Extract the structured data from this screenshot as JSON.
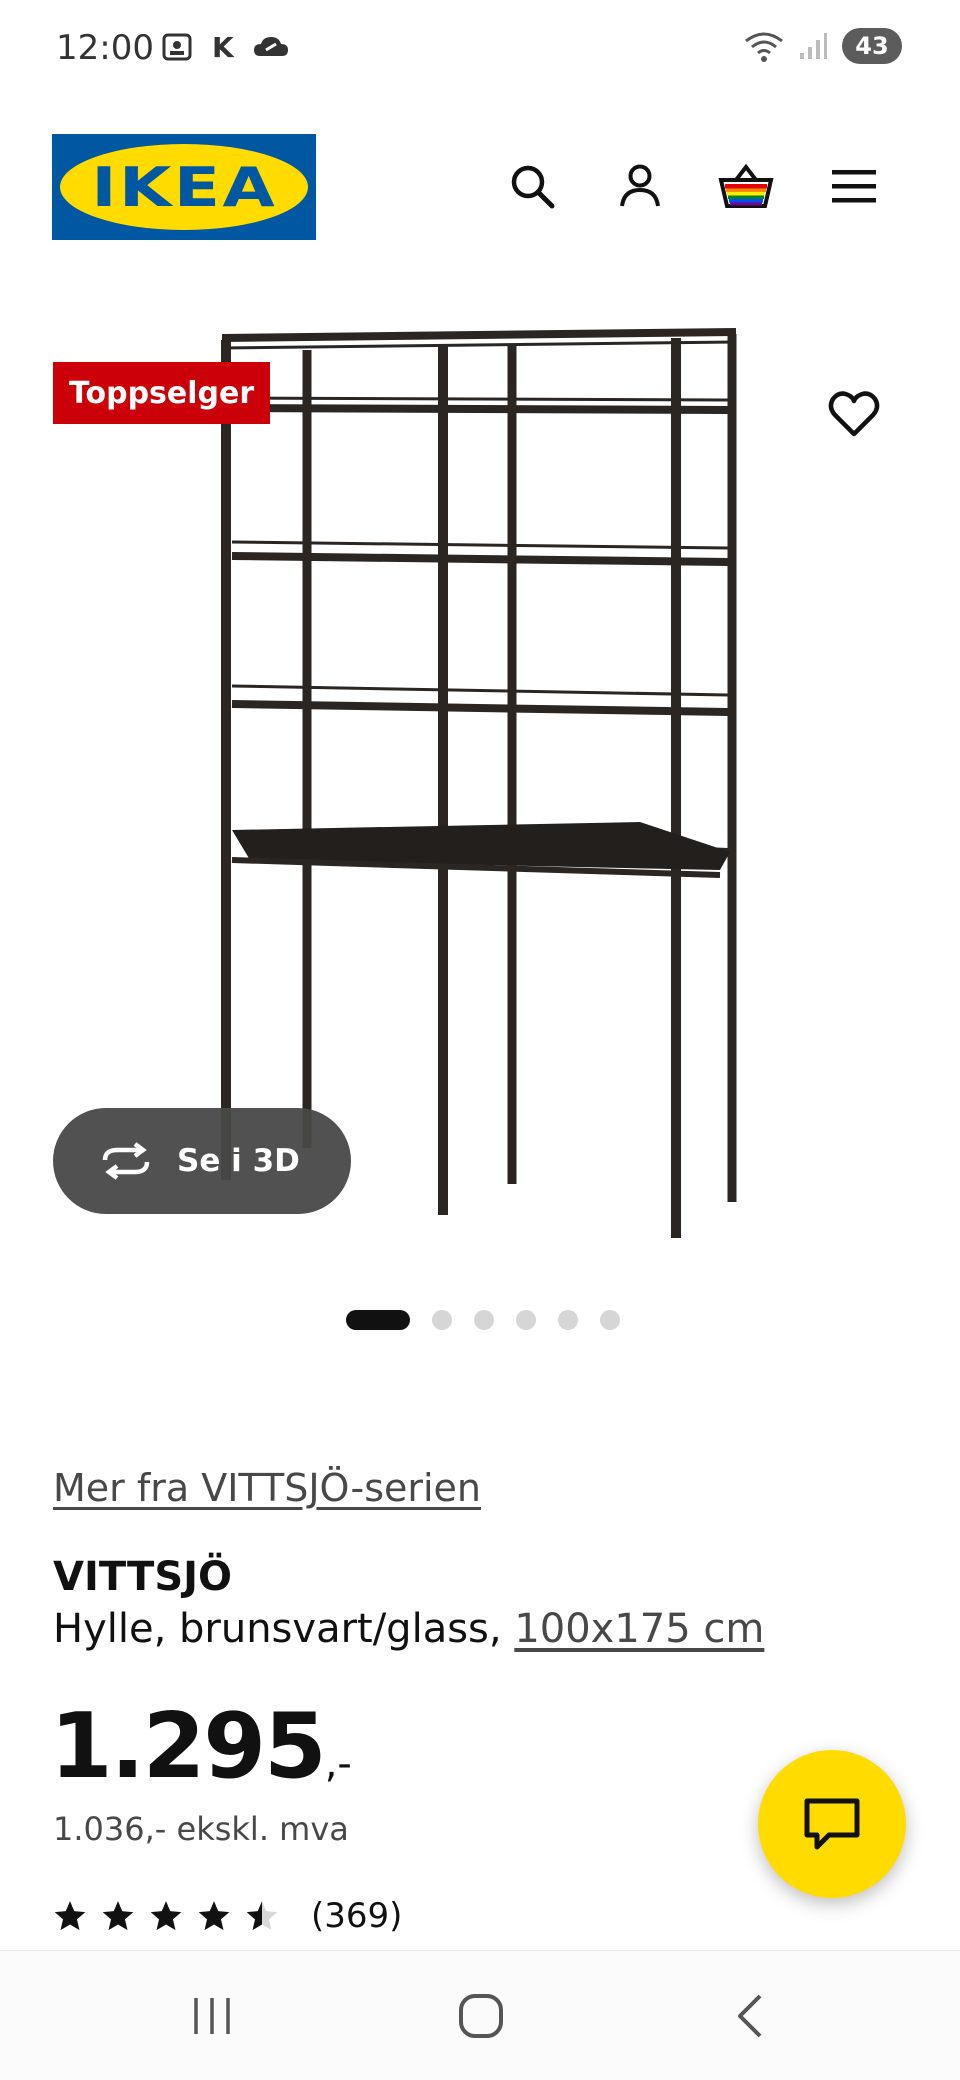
{
  "status_bar": {
    "time": "12:00",
    "k_label": "K",
    "battery": "43"
  },
  "header": {
    "logo_text": "IKEA",
    "icons": [
      "search-icon",
      "account-icon",
      "basket-icon",
      "menu-icon"
    ]
  },
  "gallery": {
    "badge": "Toppselger",
    "see_3d_label": "Se i 3D",
    "image_count": 6,
    "active_index": 0
  },
  "product": {
    "series_link": "Mer fra VITTSJÖ-serien",
    "name": "VITTSJÖ",
    "description": "Hylle, brunsvart/glass, ",
    "size_link": "100x175 cm",
    "price": "1.295",
    "price_suffix": ",-",
    "price_ex_vat": "1.036,- ekskl. mva",
    "rating": 4.5,
    "rating_count": "(369)"
  },
  "colors": {
    "ikea_blue": "#0058A3",
    "ikea_yellow": "#FFDB00",
    "badge_red": "#CC0008",
    "shelf_frame": "#2b2622"
  }
}
